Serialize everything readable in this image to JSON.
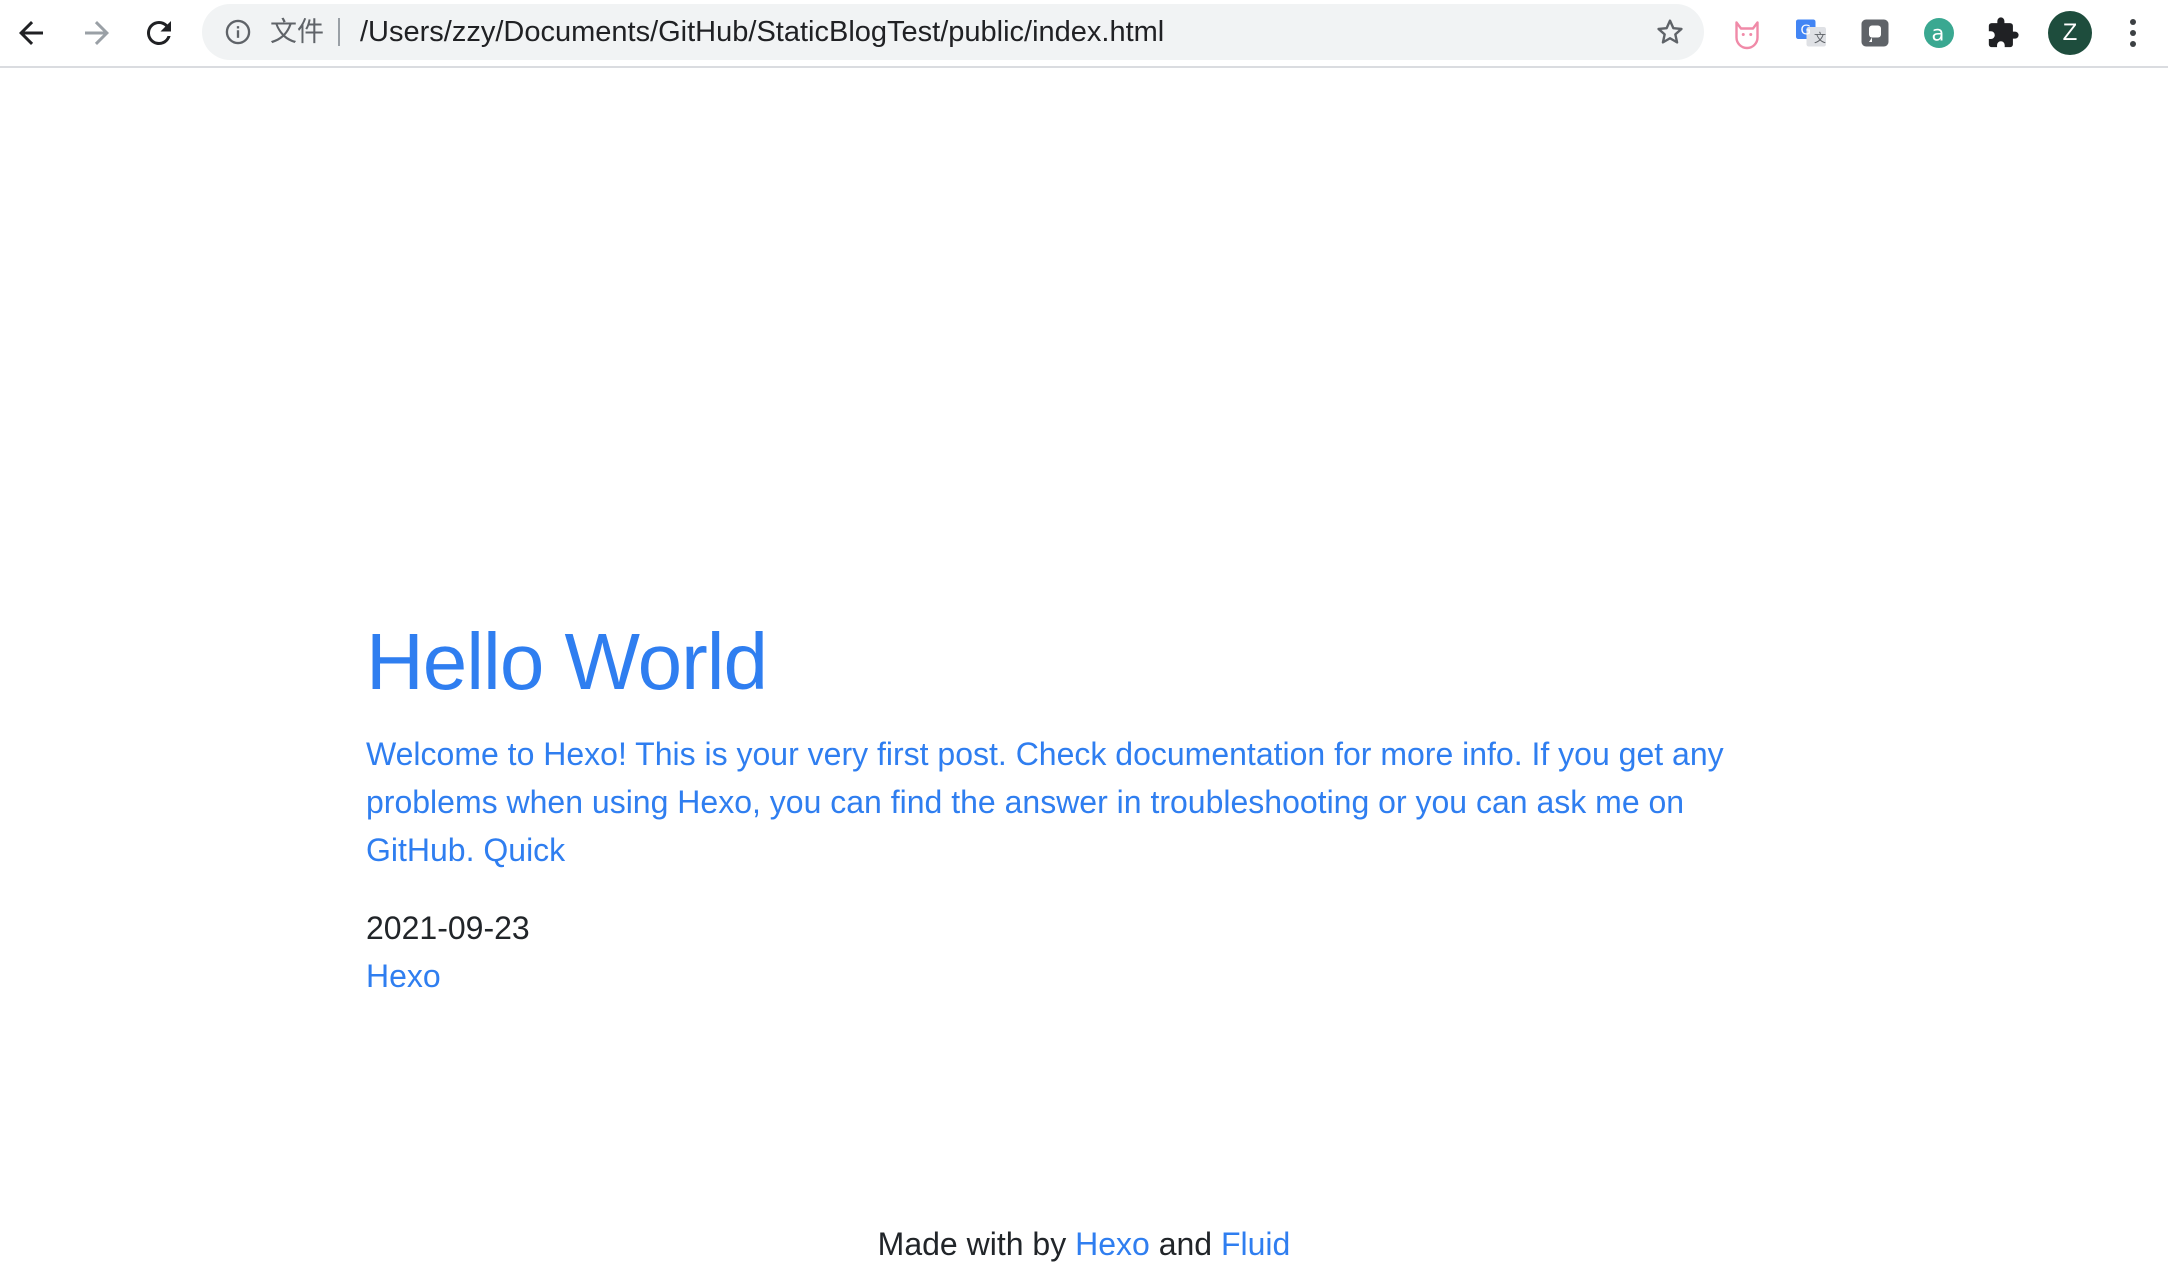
{
  "browser": {
    "url_scheme_label": "文件",
    "url": "/Users/zzy/Documents/GitHub/StaticBlogTest/public/index.html",
    "profile_initial": "Z",
    "extensions": [
      "cat-extension-icon",
      "google-translate-icon",
      "puzzle-square-icon",
      "letter-a-icon",
      "puzzle-icon"
    ],
    "colors": {
      "avatar_bg": "#1e4d3d",
      "omnibox_bg": "#f1f3f4"
    }
  },
  "post": {
    "title": "Hello World",
    "excerpt": "Welcome to Hexo! This is your very first post. Check documentation for more info. If you get any problems when using Hexo, you can find the answer in troubleshooting or you can ask me on GitHub. Quick",
    "date": "2021-09-23",
    "category": "Hexo"
  },
  "footer": {
    "prefix": "Made with by",
    "link1": "Hexo",
    "middle": "and",
    "link2": "Fluid"
  },
  "theme": {
    "link_color": "#2f7ef0",
    "text_color": "#212529"
  }
}
